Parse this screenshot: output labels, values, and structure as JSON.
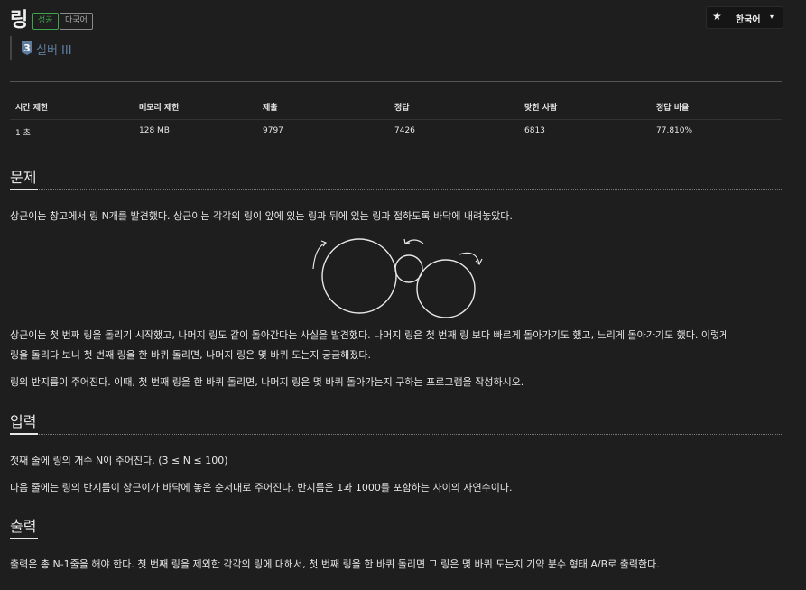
{
  "problem": {
    "title": "링",
    "badges": {
      "success": "성공",
      "multilang": "다국어"
    },
    "tier": {
      "number": "3",
      "label": "실버 III"
    }
  },
  "language_button": {
    "label": "한국어",
    "star_icon": "★",
    "caret_icon": "▾"
  },
  "stats": {
    "headers": [
      "시간 제한",
      "메모리 제한",
      "제출",
      "정답",
      "맞힌 사람",
      "정답 비율"
    ],
    "values": [
      "1 초",
      "128 MB",
      "9797",
      "7426",
      "6813",
      "77.810%"
    ]
  },
  "sections": {
    "problem": {
      "title": "문제",
      "paragraph1": "상근이는 창고에서 링 N개를 발견했다. 상근이는 각각의 링이 앞에 있는 링과 뒤에 있는 링과 접하도록 바닥에 내려놓았다.",
      "paragraph2_line1": "상근이는 첫 번째 링을 돌리기 시작했고, 나머지 링도 같이 돌아간다는 사실을 발견했다. 나머지 링은 첫 번째 링 보다 빠르게 돌아가기도 했고, 느리게 돌아가기도 했다. 이렇게",
      "paragraph2_line2": "링을 돌리다 보니 첫 번째 링을 한 바퀴 돌리면, 나머지 링은 몇 바퀴 도는지 궁금해졌다.",
      "paragraph3": "링의 반지름이 주어진다. 이때, 첫 번째 링을 한 바퀴 돌리면, 나머지 링은 몇 바퀴 돌아가는지 구하는 프로그램을 작성하시오."
    },
    "input": {
      "title": "입력",
      "line1": "첫째 줄에 링의 개수 N이 주어진다. (3 ≤ N ≤ 100)",
      "line2": "다음 줄에는 링의 반지름이 상근이가 바닥에 놓은 순서대로 주어진다. 반지름은 1과 1000를 포함하는 사이의 자연수이다."
    },
    "output": {
      "title": "출력",
      "line1": "출력은 총 N-1줄을 해야 한다. 첫 번째 링을 제외한 각각의 링에 대해서, 첫 번째 링을 한 바퀴 돌리면 그 링은 몇 바퀴 도는지 기약 분수 형태 A/B로 출력한다."
    }
  },
  "colors": {
    "background": "#1e1e1e",
    "success": "#3fa34d",
    "tier": "#5d7c9e"
  }
}
